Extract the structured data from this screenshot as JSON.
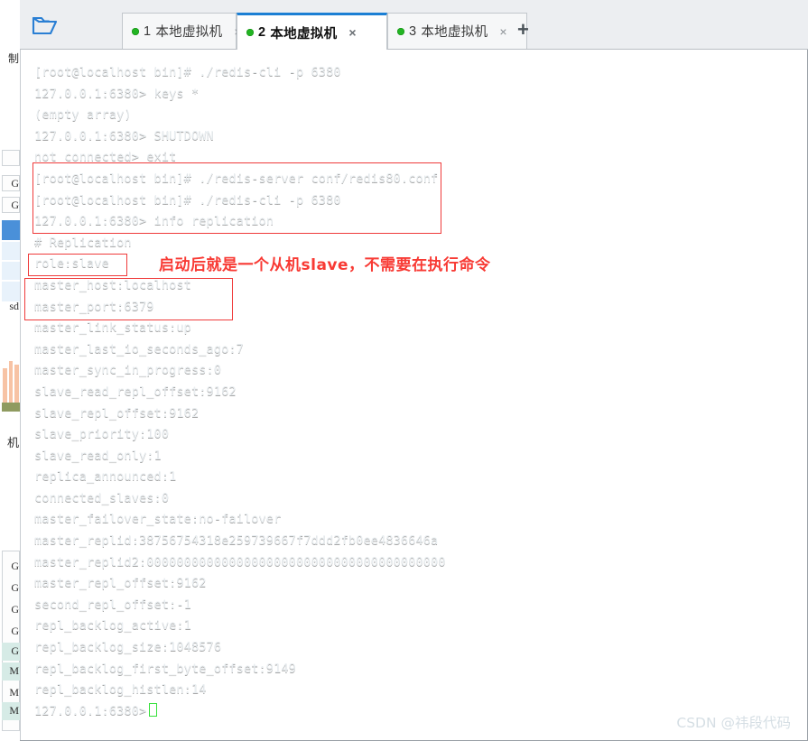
{
  "window": {
    "tabs": [
      {
        "index": "1",
        "label": "本地虚拟机",
        "status_color": "#22b422",
        "active": false,
        "close_label": "×"
      },
      {
        "index": "2",
        "label": "本地虚拟机",
        "status_color": "#22b422",
        "active": true,
        "close_label": "×"
      },
      {
        "index": "3",
        "label": "本地虚拟机",
        "status_color": "#22b422",
        "active": false,
        "close_label": "×"
      }
    ],
    "new_tab_label": "+",
    "folder_icon": "open-folder-icon",
    "accent_color": "#1b7fd4"
  },
  "terminal": {
    "background_color": "#3c6377",
    "text_color": "#e9eef1",
    "cursor_color": "#35e03a",
    "lines": [
      "[root@localhost bin]# ./redis-cli -p 6380",
      "127.0.0.1:6380> keys *",
      "(empty array)",
      "127.0.0.1:6380> SHUTDOWN",
      "not connected> exit",
      "[root@localhost bin]# ./redis-server conf/redis80.conf",
      "[root@localhost bin]# ./redis-cli -p 6380",
      "127.0.0.1:6380> info replication",
      "# Replication",
      "role:slave",
      "master_host:localhost",
      "master_port:6379",
      "master_link_status:up",
      "master_last_io_seconds_ago:7",
      "master_sync_in_progress:0",
      "slave_read_repl_offset:9162",
      "slave_repl_offset:9162",
      "slave_priority:100",
      "slave_read_only:1",
      "replica_announced:1",
      "connected_slaves:0",
      "master_failover_state:no-failover",
      "master_replid:38756754318e259739667f7ddd2fb0ee4836646a",
      "master_replid2:0000000000000000000000000000000000000000",
      "master_repl_offset:9162",
      "second_repl_offset:-1",
      "repl_backlog_active:1",
      "repl_backlog_size:1048576",
      "repl_backlog_first_byte_offset:9149",
      "repl_backlog_histlen:14"
    ],
    "prompt_line": "127.0.0.1:6380>"
  },
  "annotations": {
    "color": "#f83a34",
    "note_text": "启动后就是一个从机slave，不需要在执行命令",
    "boxes": [
      {
        "name": "startup-commands-box"
      },
      {
        "name": "role-slave-box"
      },
      {
        "name": "master-info-box"
      }
    ]
  },
  "watermark": {
    "text": "CSDN @祎段代码"
  },
  "background_panel": {
    "labels_top": [
      "制"
    ],
    "labels_mid": [
      "G",
      "G",
      "sd"
    ],
    "label_machine": "机",
    "labels_bottom": [
      "G",
      "G",
      "G",
      "G",
      "G",
      "M",
      "M",
      "M"
    ]
  }
}
